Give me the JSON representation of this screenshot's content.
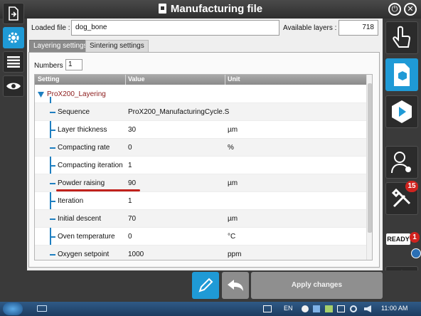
{
  "window": {
    "title": "Manufacturing file"
  },
  "file": {
    "loaded_label": "Loaded file :",
    "loaded_value": "dog_bone",
    "layers_label": "Available layers :",
    "layers_value": "718"
  },
  "tabs": [
    {
      "label": "Layering settings",
      "active": true
    },
    {
      "label": "Sintering settings",
      "active": false
    }
  ],
  "numbers": {
    "label": "Numbers",
    "value": "1"
  },
  "grid": {
    "headers": [
      "Setting",
      "Value",
      "Unit"
    ],
    "group": "ProX200_Layering",
    "rows": [
      {
        "setting": "Sequence",
        "value": "ProX200_ManufacturingCycle.S",
        "unit": ""
      },
      {
        "setting": "Layer thickness",
        "value": "30",
        "unit": "µm"
      },
      {
        "setting": "Compacting rate",
        "value": "0",
        "unit": "%"
      },
      {
        "setting": "Compacting iteration",
        "value": "1",
        "unit": ""
      },
      {
        "setting": "Powder raising",
        "value": "90",
        "unit": "µm"
      },
      {
        "setting": "Iteration",
        "value": "1",
        "unit": ""
      },
      {
        "setting": "Initial descent",
        "value": "70",
        "unit": "µm"
      },
      {
        "setting": "Oven temperature",
        "value": "0",
        "unit": "°C"
      },
      {
        "setting": "Oxygen setpoint",
        "value": "1000",
        "unit": "ppm"
      }
    ]
  },
  "actions": {
    "apply_label": "Apply changes"
  },
  "status": {
    "ready_label": "READY",
    "ready_count": "1",
    "tools_count": "15"
  },
  "taskbar": {
    "language": "EN",
    "time": "11:00 AM"
  },
  "colors": {
    "accent": "#1f9ad6",
    "highlight_underline": "#c0211c",
    "tree_line": "#1f7fc0"
  }
}
